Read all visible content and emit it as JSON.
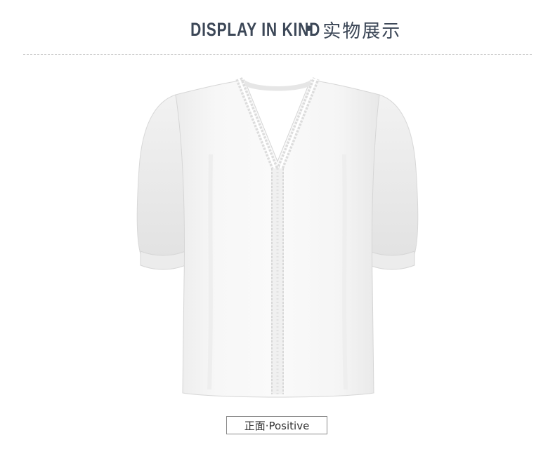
{
  "header": {
    "title_en": "DISPLAY IN KIND",
    "separator": "•",
    "title_cn": "实物展示"
  },
  "product": {
    "image": "white-v-neck-lace-trim-blouse"
  },
  "caption": {
    "label": "正面·Positive"
  },
  "colors": {
    "title": "#3c4757",
    "divider": "#c7c7c7",
    "caption_border": "#8a8a8a"
  }
}
